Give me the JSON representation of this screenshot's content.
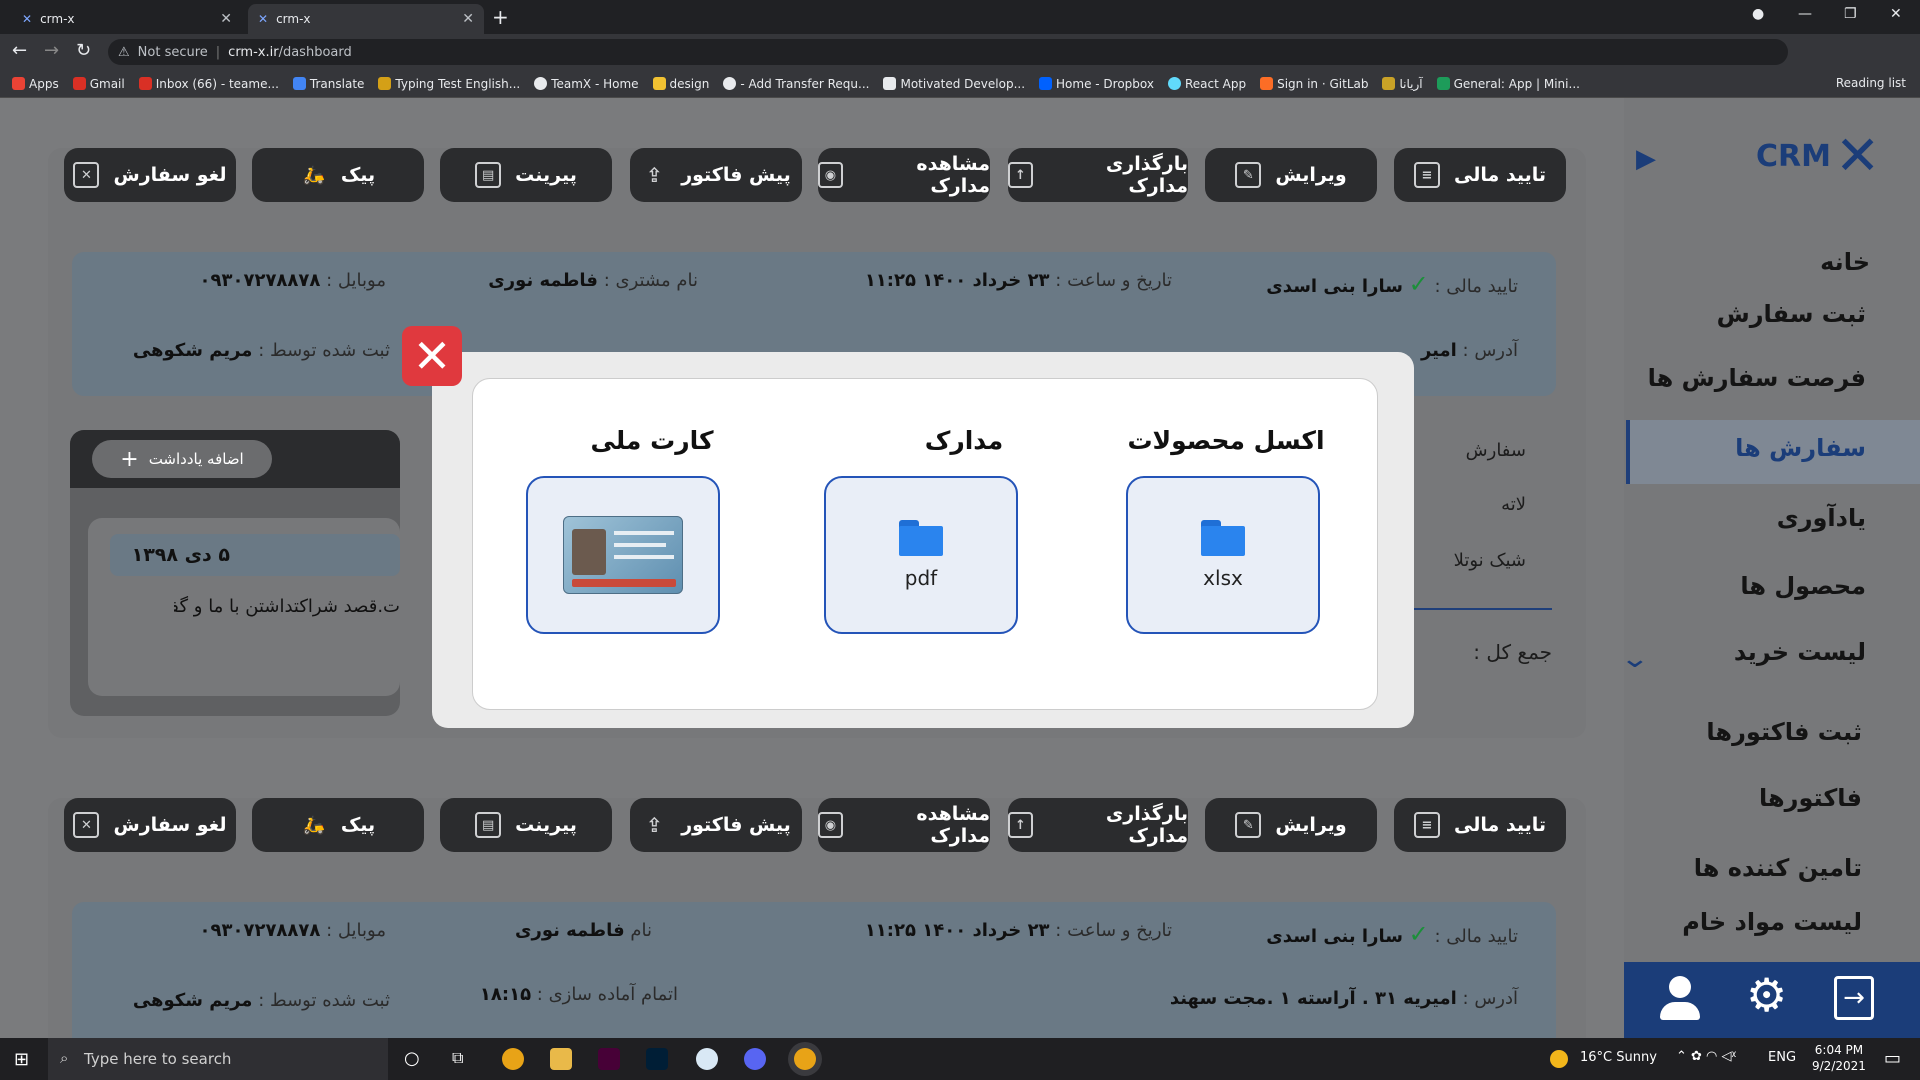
{
  "browser": {
    "tabs": [
      {
        "label": "crm-x"
      },
      {
        "label": "crm-x"
      }
    ],
    "security": "Not secure",
    "url_host": "crm-x.ir",
    "url_path": "/dashboard",
    "bookmarks": [
      "Apps",
      "Gmail",
      "Inbox (66) - teame...",
      "Translate",
      "Typing Test English...",
      "TeamX - Home",
      "design",
      "- Add Transfer Requ...",
      "Motivated Develop...",
      "Home - Dropbox",
      "React App",
      "Sign in · GitLab",
      "آریانا",
      "General: App | Mini..."
    ],
    "reading_list": "Reading list"
  },
  "brand": {
    "logo": "CRM"
  },
  "sidebar": {
    "items": [
      "خانه",
      "ثبت سفارش",
      "فرصت سفارش ها",
      "سفارش ها",
      "یادآوری",
      "محصول ها",
      "لیست خرید",
      "ثبت فاکتورها",
      "فاکتورها",
      "تامین کننده ها",
      "لیست مواد خام"
    ],
    "active_index": 3
  },
  "toolbar": {
    "buttons": [
      "تایید مالی",
      "ویرایش",
      "بارگذاری مدارک",
      "مشاهده مدارک",
      "پیش فاکتور",
      "پیرینت",
      "پیک",
      "لغو سفارش"
    ]
  },
  "order1": {
    "finance_label": "تایید مالی :",
    "finance_value": "سارا بنی اسدی",
    "datetime_label": "تاریخ و ساعت :",
    "datetime_value": "۲۳ خرداد ۱۴۰۰   ۱۱:۲۵",
    "customer_label": "نام مشتری :",
    "customer_value": "فاطمه نوری",
    "mobile_label": "موبایل :",
    "mobile_value": "۰۹۳۰۷۲۷۸۸۷۸",
    "address_label": "آدرس :",
    "address_value": "امیر",
    "registered_label": "ثبت شده توسط :",
    "registered_value": "مریم شکوهی",
    "order_label": "سفارش",
    "item1": "لاته",
    "item2": "شیک نوتلا",
    "total_label": "جمع کل :",
    "add_note": "اضافه یادداشت",
    "note_date": "۵ دی ۱۳۹۸",
    "note_text": "ت.قصد شراکتداشتن با ما و گفتن"
  },
  "order2": {
    "finance_label": "تایید مالی :",
    "finance_value": "سارا بنی اسدی",
    "datetime_label": "تاریخ و ساعت :",
    "datetime_value": "۲۳ خرداد ۱۴۰۰   ۱۱:۲۵",
    "customer_label": "نام",
    "customer_value": "فاطمه نوری",
    "mobile_label": "موبایل :",
    "mobile_value": "۰۹۳۰۷۲۷۸۸۷۸",
    "address_label": "آدرس :",
    "address_value": "امیریه ۳۱ . آراسته ۱ .مجت سهند",
    "prep_label": "اتمام آماده سازی :",
    "prep_value": "۱۸:۱۵",
    "registered_label": "ثبت شده توسط :",
    "registered_value": "مریم شکوهی"
  },
  "modal": {
    "sections": [
      {
        "title": "اکسل محصولات",
        "label": "xlsx"
      },
      {
        "title": "مدارک",
        "label": "pdf"
      },
      {
        "title": "کارت ملی",
        "label": ""
      }
    ]
  },
  "taskbar": {
    "search_placeholder": "Type here to search",
    "weather": "16°C  Sunny",
    "lang": "ENG",
    "time": "6:04 PM",
    "date": "9/2/2021"
  }
}
